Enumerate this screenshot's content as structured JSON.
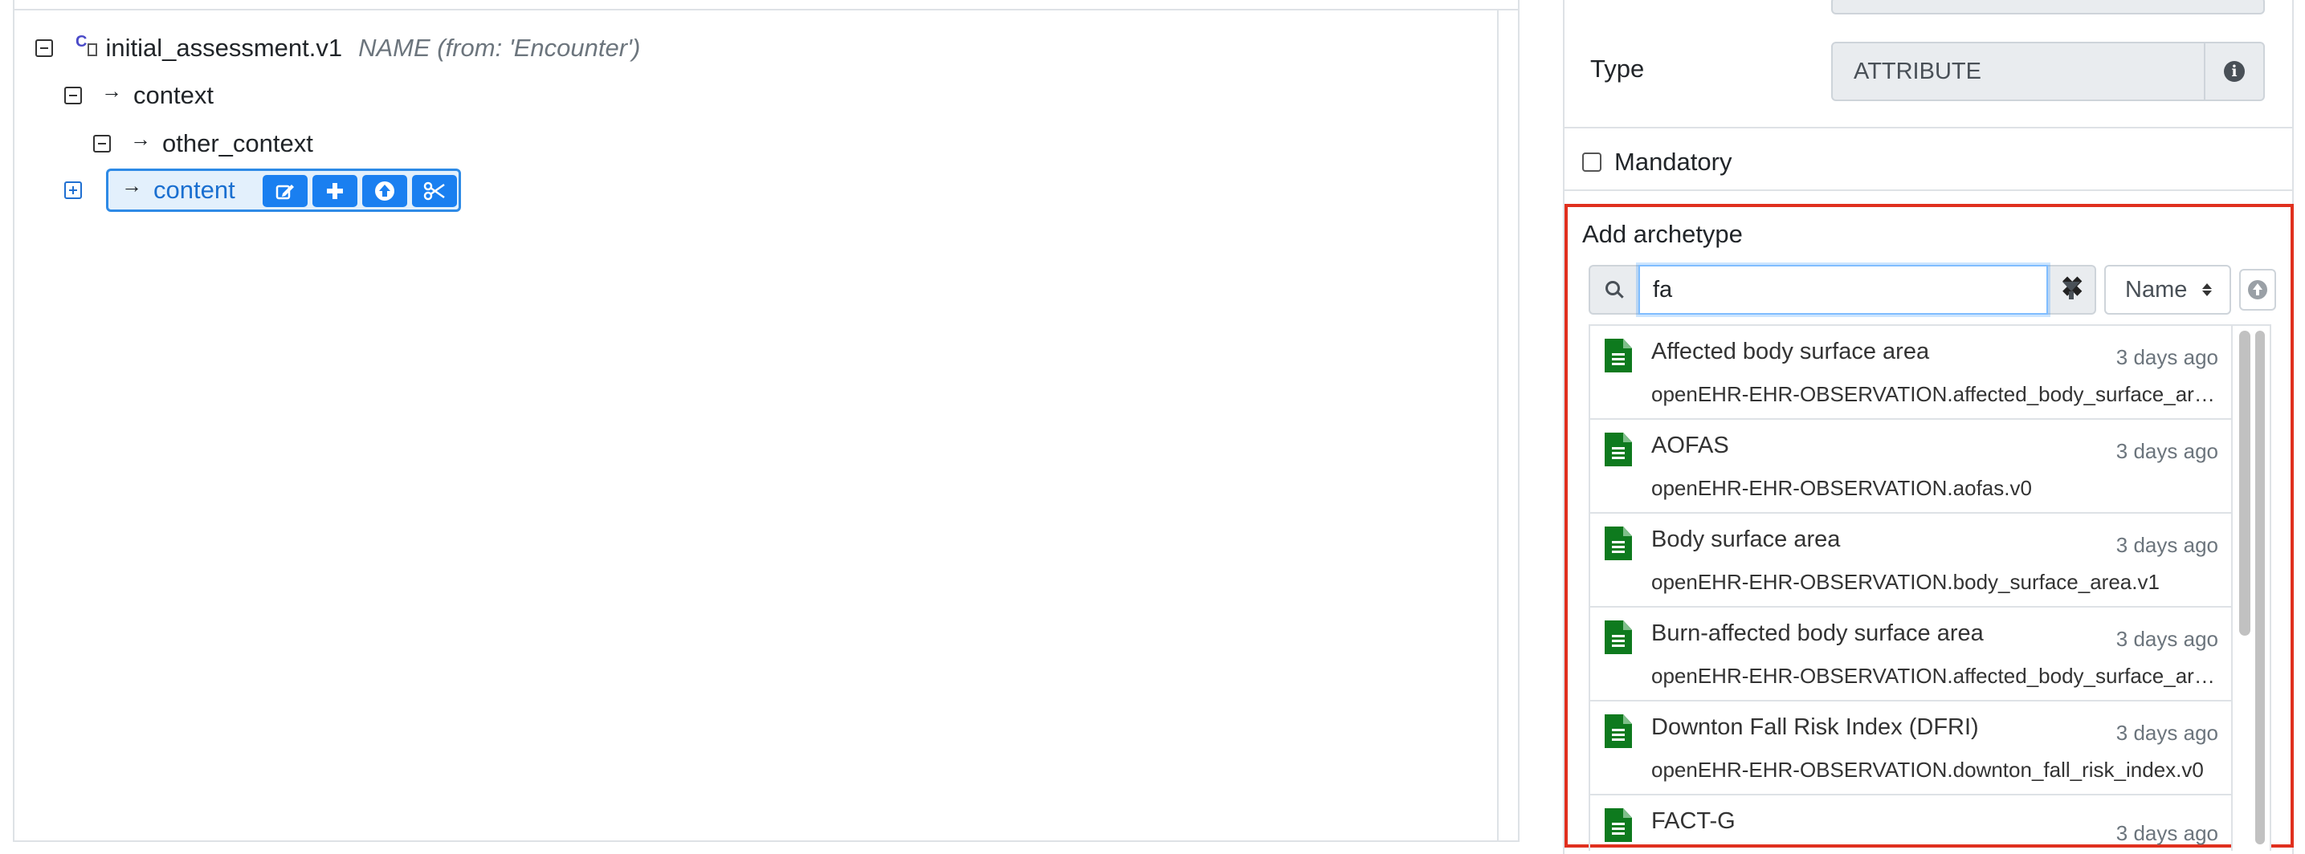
{
  "tree": {
    "root": {
      "label": "initial_assessment.v1",
      "name_hint": "NAME (from: 'Encounter')"
    },
    "context": {
      "label": "context"
    },
    "other_context": {
      "label": "other_context"
    },
    "content": {
      "label": "content"
    }
  },
  "properties": {
    "type_label": "Type",
    "type_value": "ATTRIBUTE",
    "mandatory_label": "Mandatory"
  },
  "add_archetype": {
    "title": "Add archetype",
    "search_value": "fa",
    "sort_value": "Name",
    "results": [
      {
        "name": "Affected body surface area",
        "date": "3 days ago",
        "id": "openEHR-EHR-OBSERVATION.affected_body_surface_area.v0"
      },
      {
        "name": "AOFAS",
        "date": "3 days ago",
        "id": "openEHR-EHR-OBSERVATION.aofas.v0"
      },
      {
        "name": "Body surface area",
        "date": "3 days ago",
        "id": "openEHR-EHR-OBSERVATION.body_surface_area.v1"
      },
      {
        "name": "Burn-affected body surface area",
        "date": "3 days ago",
        "id": "openEHR-EHR-OBSERVATION.affected_body_surface_area.v0"
      },
      {
        "name": "Downton Fall Risk Index (DFRI)",
        "date": "3 days ago",
        "id": "openEHR-EHR-OBSERVATION.downton_fall_risk_index.v0"
      },
      {
        "name": "FACT-G",
        "date": "3 days ago",
        "id": ""
      }
    ]
  },
  "colors": {
    "highlight_border": "#e0301e",
    "primary": "#1a7ff0",
    "doc_icon": "#0e7a1e"
  },
  "icons": {
    "node_buttons": [
      "edit-icon",
      "plus-icon",
      "arrow-up-circle-icon",
      "scissors-icon"
    ]
  }
}
